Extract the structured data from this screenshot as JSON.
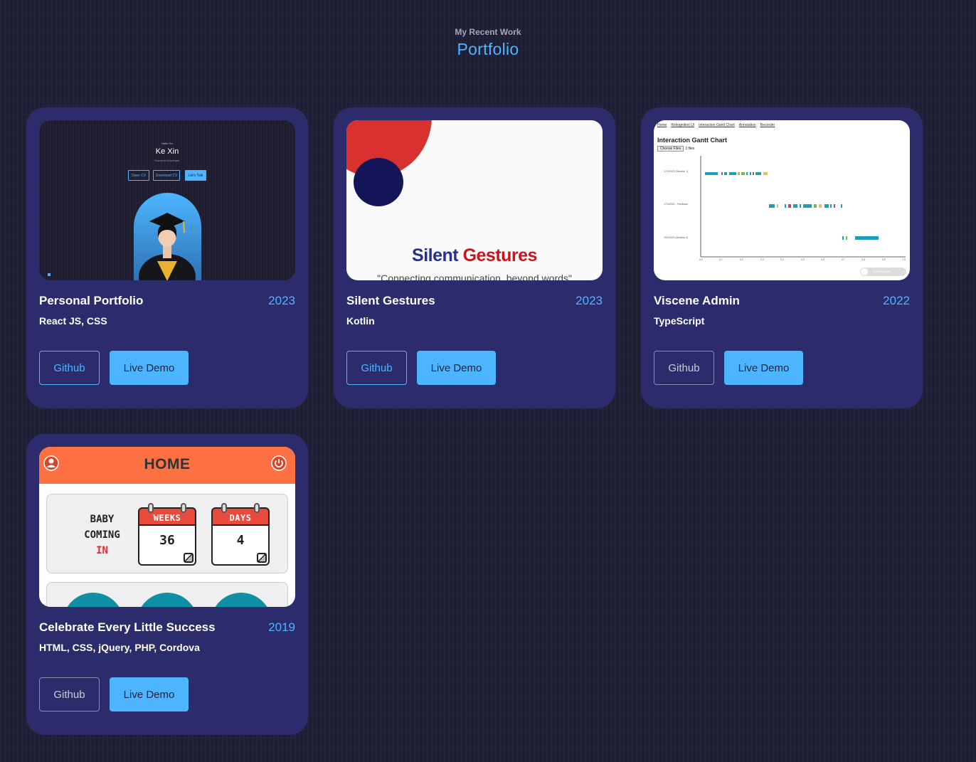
{
  "section": {
    "subtitle": "My Recent Work",
    "title": "Portfolio"
  },
  "projects": [
    {
      "title": "Personal Portfolio",
      "year": "2023",
      "tech": "React JS, CSS",
      "github_label": "Github",
      "demo_label": "Live Demo",
      "thumbnail": {
        "greeting": "Hello I'm",
        "name": "Ke Xin",
        "role": "Frontend Developer",
        "buttons": [
          "Open CV",
          "Download CV",
          "Let's Talk"
        ]
      }
    },
    {
      "title": "Silent Gestures",
      "year": "2023",
      "tech": "Kotlin",
      "github_label": "Github",
      "demo_label": "Live Demo",
      "thumbnail": {
        "heading_part1": "Silent",
        "heading_part2": "Gestures",
        "tagline": "\"Connecting communication, beyond words\""
      }
    },
    {
      "title": "Viscene Admin",
      "year": "2022",
      "tech": "TypeScript",
      "github_label": "Github",
      "demo_label": "Live Demo",
      "thumbnail": {
        "nav": [
          "Home",
          "Rekognition UI",
          "Interaction Gantt Chart",
          "Annotation",
          "Recorder"
        ],
        "chart_title": "Interaction Gantt Chart",
        "file_button": "Choose Files",
        "file_count": "3 files",
        "rows": [
          "17/2/2023 (Session 1)",
          "17/2/2022 - Feedback",
          "19/2/2023 (Session 2)"
        ],
        "ticks": [
          "0.0",
          "0.1",
          "0.2",
          "0.3",
          "0.4",
          "0.5",
          "0.6",
          "0.7",
          "0.8",
          "0.9",
          "1.0"
        ],
        "toggle_label": "NORMALIZED"
      }
    },
    {
      "title": "Celebrate Every Little Success",
      "year": "2019",
      "tech": "HTML, CSS, jQuery, PHP, Cordova",
      "github_label": "Github",
      "demo_label": "Live Demo",
      "thumbnail": {
        "home": "HOME",
        "baby_line1": "BABY",
        "baby_line2": "COMING",
        "baby_line3": "IN",
        "weeks_label": "WEEKS",
        "weeks_value": "36",
        "days_label": "DAYS",
        "days_value": "4"
      }
    }
  ],
  "colors": {
    "background": "#1f1f38",
    "card": "#2c2c6c",
    "accent": "#4db5ff"
  }
}
